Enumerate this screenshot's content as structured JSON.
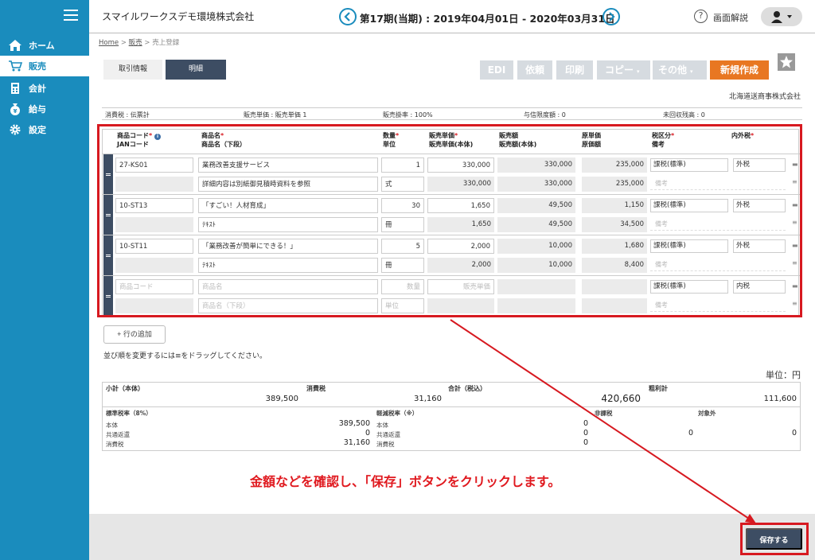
{
  "header": {
    "company": "スマイルワークスデモ環境株式会社",
    "period": "第17期(当期) : 2019年04月01日 - 2020年03月31日",
    "help_label": "画面解説"
  },
  "sidebar": {
    "items": [
      {
        "label": "ホーム",
        "icon": "home-icon"
      },
      {
        "label": "販売",
        "icon": "cart-icon"
      },
      {
        "label": "会計",
        "icon": "calculator-icon"
      },
      {
        "label": "給与",
        "icon": "money-bag-icon"
      },
      {
        "label": "設定",
        "icon": "gear-icon"
      }
    ],
    "active_index": 1
  },
  "breadcrumb": {
    "home": "Home",
    "sep1": ">",
    "sales": "販売",
    "sep2": ">",
    "current": "売上登録"
  },
  "tabs": {
    "info": "取引情報",
    "detail": "明細"
  },
  "toolbar": {
    "edi": "EDI",
    "request": "依頼",
    "print": "印刷",
    "copy": "コピー",
    "other": "その他",
    "new": "新規作成"
  },
  "customer": "北海道送商事株式会社",
  "info_bar": {
    "tax": "消費税 : 伝票計",
    "unit_price": "販売単価 : 販売単価 1",
    "rate": "販売掛率 : 100%",
    "credit": "与信限度額 : 0",
    "unpaid": "未回収残高 : 0"
  },
  "columns": {
    "code": "商品コード",
    "jan": "JANコード",
    "name": "商品名",
    "name2": "商品名（下段）",
    "qty": "数量",
    "unit": "単位",
    "price": "販売単価",
    "price2": "販売単価(本体)",
    "amount": "販売額",
    "amount2": "販売額(本体)",
    "cost": "原単価",
    "cost2": "原価額",
    "taxcat": "税区分",
    "memo": "備考",
    "inex": "内外税"
  },
  "rows": [
    {
      "code": "27-KS01",
      "jan": "",
      "name": "業務改善支援サービス",
      "name2": "詳細内容は別紙御見積時資料を参照",
      "qty": "1",
      "unit": "式",
      "price": "330,000",
      "price2": "330,000",
      "amount": "330,000",
      "amount2": "330,000",
      "cost": "235,000",
      "cost2": "235,000",
      "taxcat": "課税(標準)",
      "inex": "外税",
      "memo": "備考"
    },
    {
      "code": "10-ST13",
      "jan": "",
      "name": "「すごい！人材育成」",
      "name2": "ﾃｷｽﾄ",
      "qty": "30",
      "unit": "冊",
      "price": "1,650",
      "price2": "1,650",
      "amount": "49,500",
      "amount2": "49,500",
      "cost": "1,150",
      "cost2": "34,500",
      "taxcat": "課税(標準)",
      "inex": "外税",
      "memo": "備考"
    },
    {
      "code": "10-ST11",
      "jan": "",
      "name": "「業務改善が簡単にできる！」",
      "name2": "ﾃｷｽﾄ",
      "qty": "5",
      "unit": "冊",
      "price": "2,000",
      "price2": "2,000",
      "amount": "10,000",
      "amount2": "10,000",
      "cost": "1,680",
      "cost2": "8,400",
      "taxcat": "課税(標準)",
      "inex": "外税",
      "memo": "備考"
    }
  ],
  "empty_row": {
    "code": "商品コード",
    "name": "商品名",
    "name2": "商品名（下段）",
    "qty": "数量",
    "unit": "単位",
    "price": "販売単価",
    "taxcat": "課税(標準)",
    "inex": "内税",
    "memo": "備考"
  },
  "add_row": "+ 行の追加",
  "drag_hint": "並び順を変更するには≡をドラッグしてください。",
  "unit_label": "単位：円",
  "summary": {
    "subtotal_label": "小計（本体）",
    "subtotal": "389,500",
    "tax_label": "消費税",
    "tax": "31,160",
    "total_label": "合計（税込）",
    "total": "420,660",
    "profit_label": "粗利計",
    "profit": "111,600"
  },
  "rates": {
    "std_label": "標準税率（8%）",
    "red_label": "軽減税率（※）",
    "nontax_label": "非課税",
    "exempt_label": "対象外",
    "body": "本体",
    "common": "共通返還",
    "ctax": "消費税",
    "std_body": "389,500",
    "std_common": "0",
    "std_tax": "31,160",
    "red_body": "0",
    "red_common": "0",
    "red_tax": "0",
    "nontax": "0",
    "exempt": "0"
  },
  "callout": "金額などを確認し、「保存」ボタンをクリックします。",
  "save_label": "保存する",
  "colors": {
    "sidebar": "#1a8cbd",
    "accent_orange": "#e87722",
    "navy": "#3d4d63",
    "highlight": "#d71920"
  }
}
